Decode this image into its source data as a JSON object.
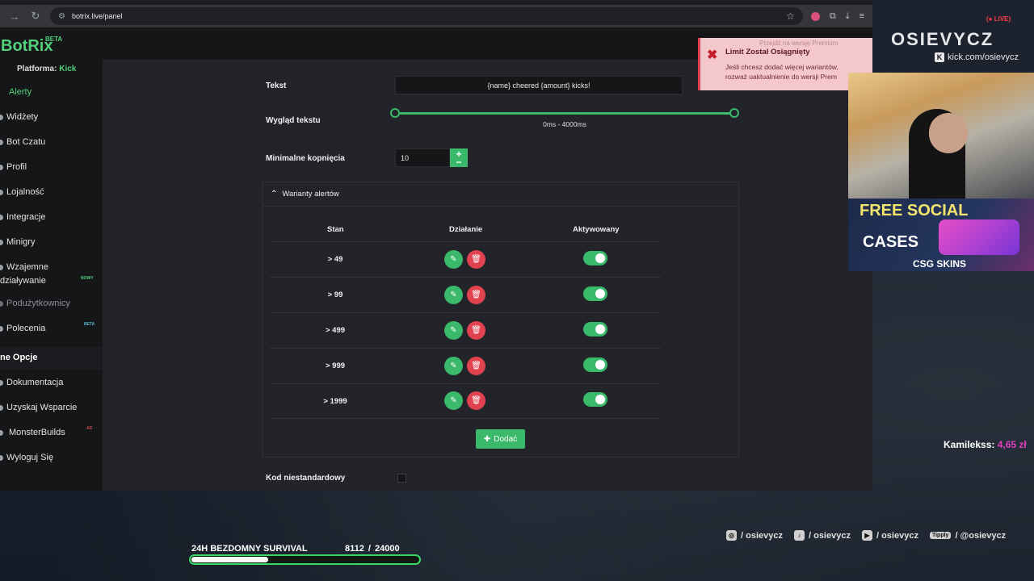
{
  "browser": {
    "url": "botrix.live/panel"
  },
  "app": {
    "logo": "BotRix",
    "logo_badge": "BETA",
    "platform_label": "Platforma:",
    "platform_value": "Kick"
  },
  "sidebar": {
    "items": [
      {
        "label": "Alerty"
      },
      {
        "label": "Widżety"
      },
      {
        "label": "Bot Czatu"
      },
      {
        "label": "Profil"
      },
      {
        "label": "Lojalność"
      },
      {
        "label": "Integracje"
      },
      {
        "label": "Minigry"
      },
      {
        "label": "Wzajemne"
      },
      {
        "label": "działywanie"
      },
      {
        "label": "Podużytkownicy"
      },
      {
        "label": "Polecenia"
      }
    ],
    "badge_new": "NOWY",
    "badge_beta": "BETA",
    "section_title": "ne Opcje",
    "other_items": [
      {
        "label": "Dokumentacja"
      },
      {
        "label": "Uzyskaj Wsparcie"
      },
      {
        "label": "MonsterBuilds"
      },
      {
        "label": "Wyloguj Się"
      }
    ],
    "ad_badge": "AD"
  },
  "form": {
    "text_label": "Tekst",
    "text_value": "{name} cheered {amount} kicks!",
    "appearance_label": "Wygląd tekstu",
    "appearance_range": "0ms - 4000ms",
    "min_kicks_label": "Minimalne kopnięcia",
    "min_kicks_value": "10",
    "custom_code_label": "Kod niestandardowy"
  },
  "variants": {
    "title": "Warianty alertów",
    "headers": {
      "stan": "Stan",
      "action": "Działanie",
      "active": "Aktywowany"
    },
    "rows": [
      {
        "stan": "> 49",
        "active": true
      },
      {
        "stan": "> 99",
        "active": true
      },
      {
        "stan": "> 499",
        "active": true
      },
      {
        "stan": "> 999",
        "active": true
      },
      {
        "stan": "> 1999",
        "active": true
      }
    ],
    "add_label": "Dodać"
  },
  "toast": {
    "title": "Limit Został Osiągnięty",
    "body_line1": "Jeśli chcesz dodać więcej wariantów,",
    "body_line2": "rozważ uaktualnienie do wersji Prem",
    "bleed_text": "Przejdź na wersję Premium"
  },
  "stream": {
    "live": "LIVE",
    "brand": "OSIEVYCZ",
    "kick_url": "kick.com/osievycz",
    "promo_line1": "FREE SOCIAL",
    "promo_line2": "CASES",
    "promo_brand": "CSG SKINS",
    "donor_name": "Kamilekss:",
    "donor_amount": "4,65 zł",
    "goal_title": "24H BEZDOMNY SURVIVAL",
    "goal_count": "8112  / 24000",
    "goal_progress": 0.338,
    "socials": [
      {
        "icon": "instagram-icon",
        "text": "/ osievycz"
      },
      {
        "icon": "tiktok-icon",
        "text": "/ osievycz"
      },
      {
        "icon": "youtube-icon",
        "text": "/ osievycz"
      },
      {
        "icon": "tipply-icon",
        "text": "/ @osievycz",
        "badge": "Tipply"
      }
    ]
  },
  "colors": {
    "accent": "#3bb96a",
    "danger": "#e0424f",
    "brand_green": "#52d07a"
  }
}
